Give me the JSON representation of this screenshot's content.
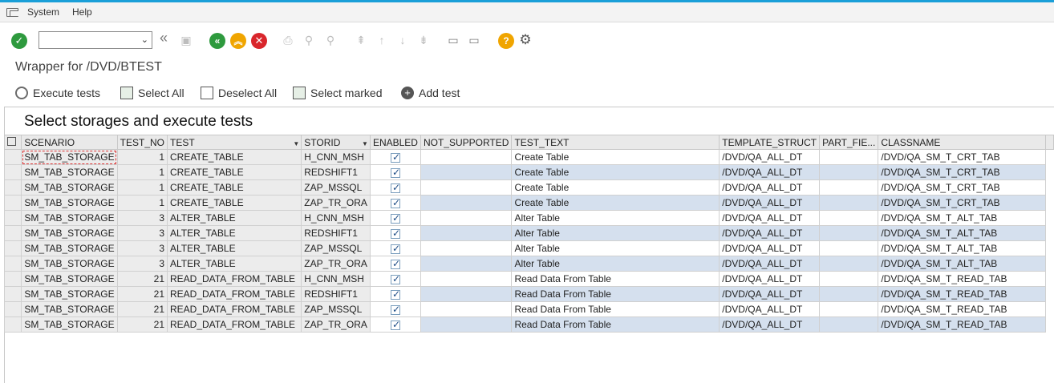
{
  "menu": {
    "items": [
      "System",
      "Help"
    ]
  },
  "toolbar": {
    "command_field_value": "",
    "icons": [
      "enter-icon",
      "back-double-icon",
      "save-icon",
      "back-icon",
      "exit-icon",
      "cancel-icon",
      "print-icon",
      "find-icon",
      "find-next-icon",
      "first-page-icon",
      "previous-page-icon",
      "next-page-icon",
      "last-page-icon",
      "create-session-icon",
      "shortcut-icon",
      "help-icon",
      "settings-icon"
    ]
  },
  "title": "Wrapper for /DVD/BTEST",
  "app_toolbar": {
    "execute": "Execute tests",
    "select_all": "Select All",
    "deselect_all": "Deselect All",
    "select_marked": "Select marked",
    "add_test": "Add test"
  },
  "section_title": "Select storages and execute tests",
  "table": {
    "columns": [
      "SCENARIO",
      "TEST_NO",
      "TEST",
      "STORID",
      "ENABLED",
      "NOT_SUPPORTED",
      "TEST_TEXT",
      "TEMPLATE_STRUCT",
      "PART_FIE...",
      "CLASSNAME"
    ],
    "rows": [
      [
        "SM_TAB_STORAGE",
        "1",
        "CREATE_TABLE",
        "H_CNN_MSH",
        "",
        "",
        "Create Table",
        "/DVD/QA_ALL_DT",
        "",
        "/DVD/QA_SM_T_CRT_TAB"
      ],
      [
        "SM_TAB_STORAGE",
        "1",
        "CREATE_TABLE",
        "REDSHIFT1",
        "",
        "",
        "Create Table",
        "/DVD/QA_ALL_DT",
        "",
        "/DVD/QA_SM_T_CRT_TAB"
      ],
      [
        "SM_TAB_STORAGE",
        "1",
        "CREATE_TABLE",
        "ZAP_MSSQL",
        "",
        "",
        "Create Table",
        "/DVD/QA_ALL_DT",
        "",
        "/DVD/QA_SM_T_CRT_TAB"
      ],
      [
        "SM_TAB_STORAGE",
        "1",
        "CREATE_TABLE",
        "ZAP_TR_ORA",
        "",
        "",
        "Create Table",
        "/DVD/QA_ALL_DT",
        "",
        "/DVD/QA_SM_T_CRT_TAB"
      ],
      [
        "SM_TAB_STORAGE",
        "3",
        "ALTER_TABLE",
        "H_CNN_MSH",
        "",
        "",
        "Alter Table",
        "/DVD/QA_ALL_DT",
        "",
        "/DVD/QA_SM_T_ALT_TAB"
      ],
      [
        "SM_TAB_STORAGE",
        "3",
        "ALTER_TABLE",
        "REDSHIFT1",
        "",
        "",
        "Alter Table",
        "/DVD/QA_ALL_DT",
        "",
        "/DVD/QA_SM_T_ALT_TAB"
      ],
      [
        "SM_TAB_STORAGE",
        "3",
        "ALTER_TABLE",
        "ZAP_MSSQL",
        "",
        "",
        "Alter Table",
        "/DVD/QA_ALL_DT",
        "",
        "/DVD/QA_SM_T_ALT_TAB"
      ],
      [
        "SM_TAB_STORAGE",
        "3",
        "ALTER_TABLE",
        "ZAP_TR_ORA",
        "",
        "",
        "Alter Table",
        "/DVD/QA_ALL_DT",
        "",
        "/DVD/QA_SM_T_ALT_TAB"
      ],
      [
        "SM_TAB_STORAGE",
        "21",
        "READ_DATA_FROM_TABLE",
        "H_CNN_MSH",
        "",
        "",
        "Read Data From Table",
        "/DVD/QA_ALL_DT",
        "",
        "/DVD/QA_SM_T_READ_TAB"
      ],
      [
        "SM_TAB_STORAGE",
        "21",
        "READ_DATA_FROM_TABLE",
        "REDSHIFT1",
        "",
        "",
        "Read Data From Table",
        "/DVD/QA_ALL_DT",
        "",
        "/DVD/QA_SM_T_READ_TAB"
      ],
      [
        "SM_TAB_STORAGE",
        "21",
        "READ_DATA_FROM_TABLE",
        "ZAP_MSSQL",
        "",
        "",
        "Read Data From Table",
        "/DVD/QA_ALL_DT",
        "",
        "/DVD/QA_SM_T_READ_TAB"
      ],
      [
        "SM_TAB_STORAGE",
        "21",
        "READ_DATA_FROM_TABLE",
        "ZAP_TR_ORA",
        "",
        "",
        "Read Data From Table",
        "/DVD/QA_ALL_DT",
        "",
        "/DVD/QA_SM_T_READ_TAB"
      ]
    ],
    "enabled": [
      true,
      true,
      true,
      true,
      true,
      true,
      true,
      true,
      true,
      true,
      true,
      true
    ]
  },
  "colors": {
    "accent": "#1a9fd8",
    "green": "#2e9a3e",
    "orange": "#f0a500",
    "red": "#d9262c",
    "row_blue": "#d5e0ee"
  }
}
